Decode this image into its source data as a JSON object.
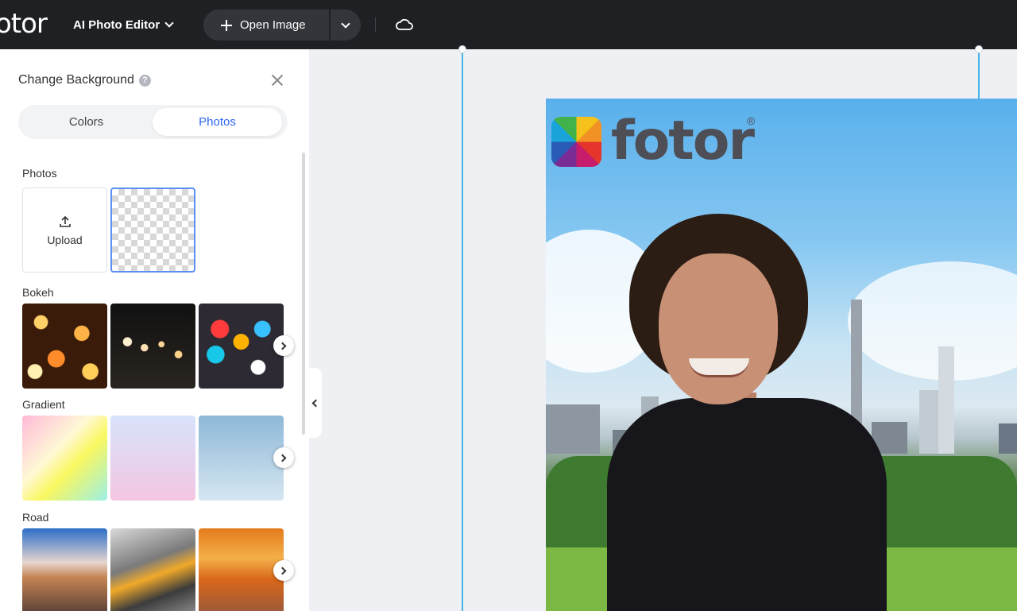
{
  "topbar": {
    "logo_text": "otor",
    "editor_menu_label": "AI Photo Editor",
    "open_image_label": "Open Image"
  },
  "panel": {
    "title": "Change Background",
    "help_glyph": "?",
    "tabs": [
      {
        "label": "Colors",
        "active": false
      },
      {
        "label": "Photos",
        "active": true
      }
    ],
    "sections": {
      "photos": {
        "label": "Photos",
        "upload_label": "Upload"
      },
      "bokeh": {
        "label": "Bokeh"
      },
      "gradient": {
        "label": "Gradient"
      },
      "road": {
        "label": "Road"
      }
    }
  },
  "canvas": {
    "brand_text": "fotor",
    "registered_mark": "®"
  },
  "colors": {
    "accent": "#2f66f2",
    "guide": "#46b4e8",
    "topbar_bg": "#1f2024"
  },
  "icons": [
    "chevron-down-icon",
    "plus-icon",
    "cloud-icon",
    "help-icon",
    "close-icon",
    "upload-icon",
    "chevron-right-icon",
    "chevron-left-icon"
  ]
}
